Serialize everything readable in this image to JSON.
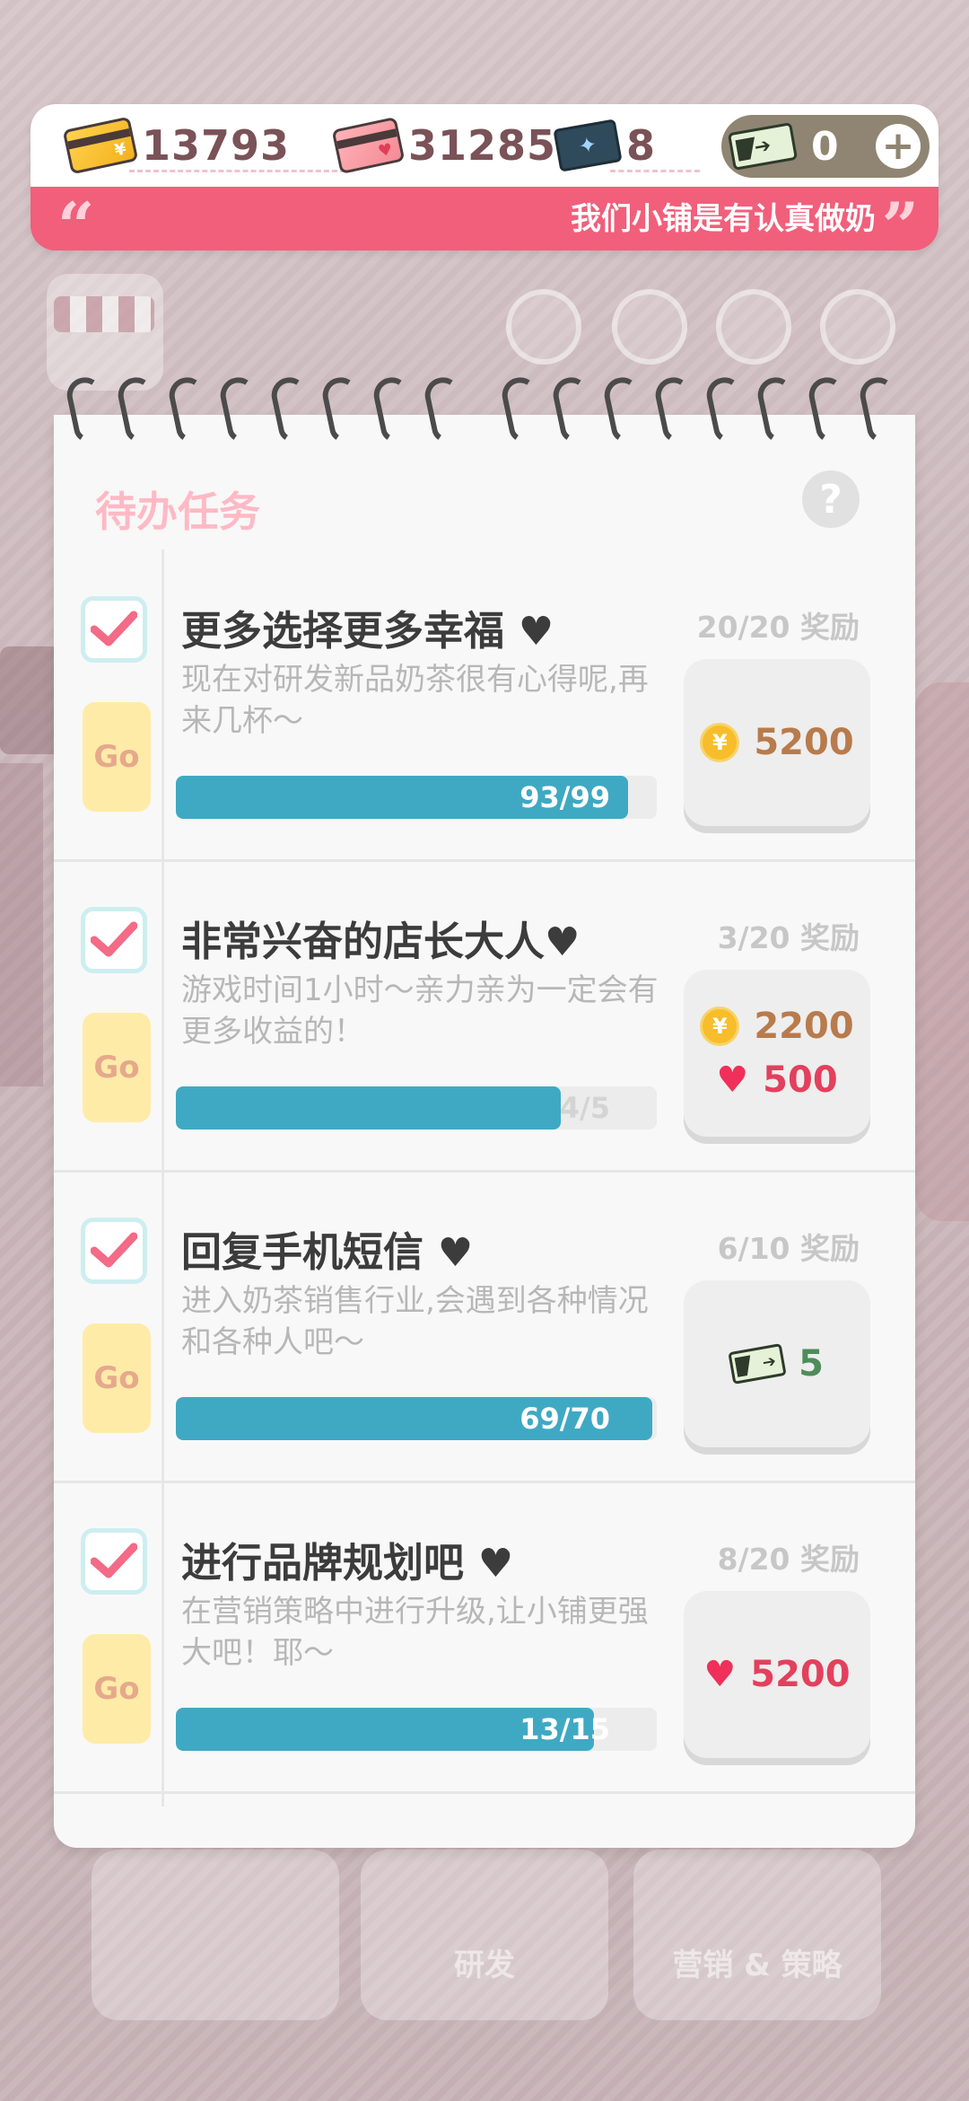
{
  "resources": {
    "gold_card": {
      "icon": "gold-card-icon",
      "value": "13793",
      "color": "#f7bd2b"
    },
    "pink_card": {
      "icon": "pink-card-icon",
      "value": "31285",
      "color": "#f48a95"
    },
    "ticket": {
      "icon": "ticket-icon",
      "value": "8"
    },
    "cash": {
      "icon": "cash-icon",
      "value": "0"
    }
  },
  "announcement": {
    "text": "我们小铺是有认真做奶",
    "quote_open": "“",
    "quote_close": "”"
  },
  "notebook": {
    "title": "待办任务",
    "help": "?",
    "tasks": [
      {
        "title": "更多选择更多幸福",
        "heart": "♥",
        "desc": "现在对研发新品奶茶很有心得呢,再来几杯～",
        "go": "Go",
        "count": "20/20 奖励",
        "progress_label": "93/99",
        "progress": 0.94,
        "rewards": [
          {
            "type": "coin",
            "icon": "yen-coin-icon",
            "value": "5200"
          }
        ]
      },
      {
        "title": "非常兴奋的店长大人",
        "heart": "♥",
        "desc": "游戏时间1小时～亲力亲为一定会有更多收益的！",
        "go": "Go",
        "count": "3/20 奖励",
        "progress_label": "4/5",
        "progress": 0.8,
        "rewards": [
          {
            "type": "coin",
            "icon": "yen-coin-icon",
            "value": "2200"
          },
          {
            "type": "heart",
            "icon": "heart-icon",
            "value": "500"
          }
        ]
      },
      {
        "title": "回复手机短信",
        "heart": "♥",
        "desc": "进入奶茶销售行业,会遇到各种情况和各种人吧～",
        "go": "Go",
        "count": "6/10 奖励",
        "progress_label": "69/70",
        "progress": 0.99,
        "rewards": [
          {
            "type": "cash",
            "icon": "cash-icon",
            "value": "5"
          }
        ]
      },
      {
        "title": "进行品牌规划吧",
        "heart": "♥",
        "desc": "在营销策略中进行升级,让小铺更强大吧！耶～",
        "go": "Go",
        "count": "8/20 奖励",
        "progress_label": "13/15",
        "progress": 0.87,
        "rewards": [
          {
            "type": "heart",
            "icon": "heart-icon",
            "value": "5200"
          }
        ]
      }
    ]
  },
  "background_buttons": [
    "研发",
    "营销 & 策略"
  ],
  "colors": {
    "accent": "#f15f7b",
    "progress": "#3fa9c3",
    "go": "#ffeba8"
  }
}
